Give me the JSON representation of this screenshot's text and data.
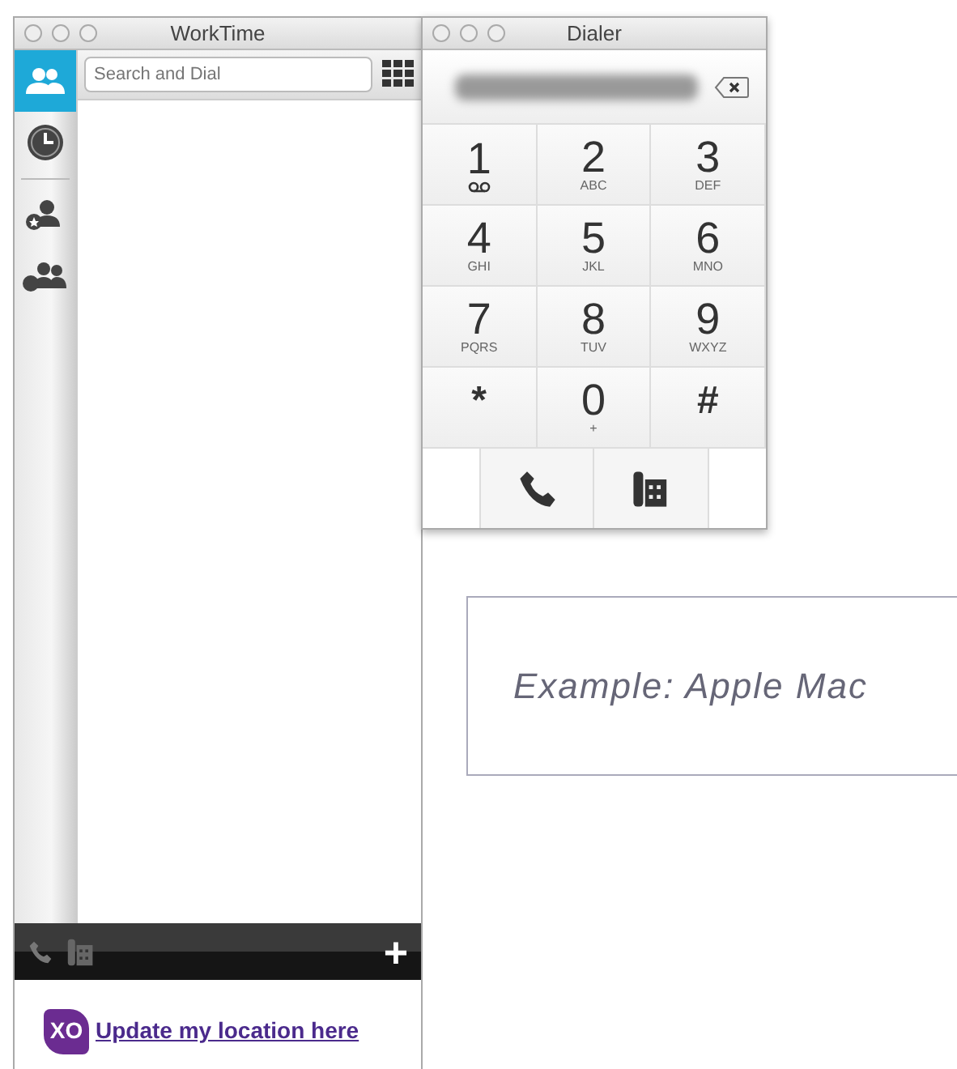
{
  "main_window": {
    "title": "WorkTime",
    "sidebar": [
      {
        "kind": "contacts",
        "selected": true
      },
      {
        "kind": "history",
        "selected": false
      },
      {
        "kind": "favorites",
        "selected": false
      },
      {
        "kind": "groups",
        "selected": false
      }
    ],
    "search": {
      "placeholder": "Search and Dial"
    },
    "footer": {
      "add_label": "+",
      "logo": "XO",
      "link": "Update my location here"
    }
  },
  "dialer": {
    "title": "Dialer",
    "keys": [
      {
        "digit": "1",
        "kind": "voicemail"
      },
      {
        "digit": "2",
        "letters": "ABC",
        "kind": "digit"
      },
      {
        "digit": "3",
        "letters": "DEF",
        "kind": "digit"
      },
      {
        "digit": "4",
        "letters": "GHI",
        "kind": "digit"
      },
      {
        "digit": "5",
        "letters": "JKL",
        "kind": "digit"
      },
      {
        "digit": "6",
        "letters": "MNO",
        "kind": "digit"
      },
      {
        "digit": "7",
        "letters": "PQRS",
        "kind": "digit"
      },
      {
        "digit": "8",
        "letters": "TUV",
        "kind": "digit"
      },
      {
        "digit": "9",
        "letters": "WXYZ",
        "kind": "digit"
      },
      {
        "digit": "*",
        "kind": "symbol"
      },
      {
        "digit": "0",
        "letters": "+",
        "kind": "digit"
      },
      {
        "digit": "#",
        "kind": "symbol"
      }
    ]
  },
  "caption": "Example: Apple Mac"
}
